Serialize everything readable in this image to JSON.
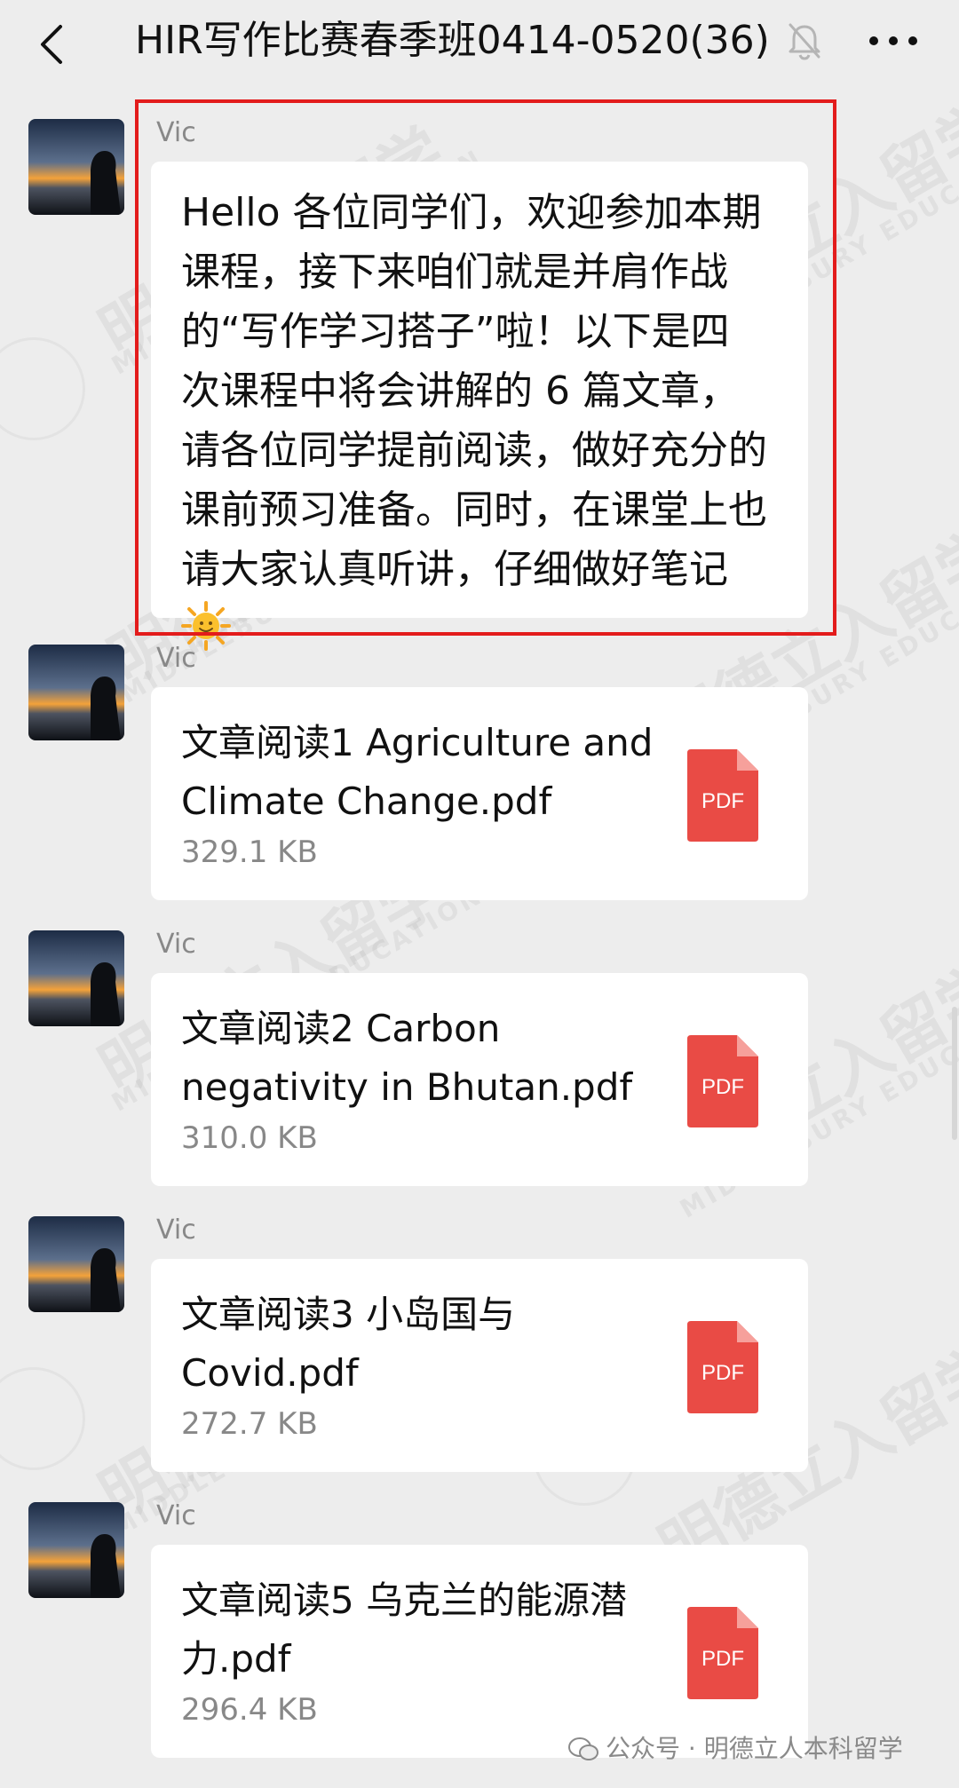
{
  "header": {
    "title": "HIR写作比赛春季班0414-0520(36)",
    "back_icon": "chevron-left-icon",
    "mute_icon": "bell-muted-icon",
    "more_icon": "more-horizontal-icon"
  },
  "messages": [
    {
      "sender": "Vic",
      "type": "text",
      "text": "Hello 各位同学们，欢迎参加本期课程，接下来咱们就是并肩作战的“写作学习搭子”啦！以下是四次课程中将会讲解的 6 篇文章，请各位同学提前阅读，做好充分的课前预习准备。同时，在课堂上也请大家认真听讲，仔细做好笔记",
      "emoji": "sun-with-face"
    },
    {
      "sender": "Vic",
      "type": "file",
      "file_name": "文章阅读1 Agriculture and Climate Change.pdf",
      "file_size": "329.1 KB",
      "file_label": "PDF"
    },
    {
      "sender": "Vic",
      "type": "file",
      "file_name": "文章阅读2 Carbon negativity in Bhutan.pdf",
      "file_size": "310.0 KB",
      "file_label": "PDF"
    },
    {
      "sender": "Vic",
      "type": "file",
      "file_name": "文章阅读3 小岛国与Covid.pdf",
      "file_size": "272.7 KB",
      "file_label": "PDF"
    },
    {
      "sender": "Vic",
      "type": "file",
      "file_name": "文章阅读5 乌克兰的能源潜力.pdf",
      "file_size": "296.4 KB",
      "file_label": "PDF"
    }
  ],
  "watermark": {
    "cn": "明德立入留学",
    "en": "MIDDLEBURY EDUCATION"
  },
  "footer": {
    "brand_text": "公众号 · 明德立人本科留学"
  },
  "colors": {
    "background": "#ededed",
    "bubble": "#ffffff",
    "highlight_border": "#e31c1c",
    "pdf_red": "#e94b45"
  }
}
